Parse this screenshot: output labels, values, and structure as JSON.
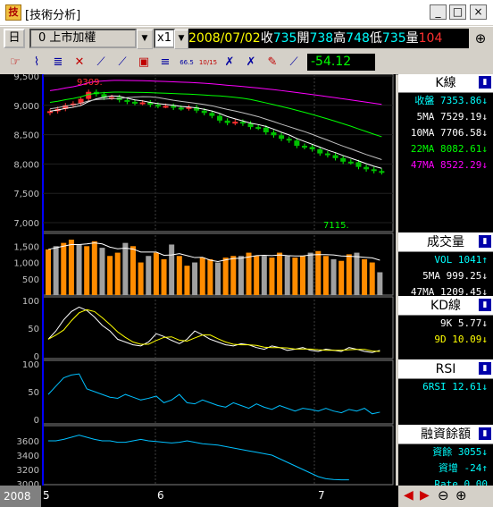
{
  "window": {
    "title": "[技術分析]",
    "min": "_",
    "max": "□",
    "close": "×"
  },
  "toolbar": {
    "period": "日",
    "stock": "0  上市加權",
    "multiplier": "x1",
    "date": "2008/07/02",
    "close_label": "收",
    "close_value": "735",
    "open_label": "開",
    "open_value": "738",
    "high_label": "高",
    "high_value": "748",
    "low_label": "低",
    "low_value": "735",
    "vol_label": "量",
    "vol_value": "104",
    "right_icon": "⊕",
    "change_value": "-54.12"
  },
  "tools": [
    {
      "name": "pointer-tool-icon",
      "glyph": "☞"
    },
    {
      "name": "k-line-tool-icon",
      "glyph": "⌇"
    },
    {
      "name": "candle-tool-icon",
      "glyph": "≣"
    },
    {
      "name": "cross-tool-icon",
      "glyph": "✕"
    },
    {
      "name": "fan-tool-icon",
      "glyph": "⟋"
    },
    {
      "name": "gann-tool-icon",
      "glyph": "⟋"
    },
    {
      "name": "box-tool-icon",
      "glyph": "▣"
    },
    {
      "name": "lines-tool-icon",
      "glyph": "≡"
    },
    {
      "name": "fib-66-tool-icon",
      "glyph": "66.5"
    },
    {
      "name": "fib-1015-tool-icon",
      "glyph": "10/15"
    },
    {
      "name": "delete-tool-icon",
      "glyph": "✗"
    },
    {
      "name": "erase-tool-icon",
      "glyph": "✗"
    },
    {
      "name": "pen-tool-icon",
      "glyph": "✎"
    },
    {
      "name": "line-tool-icon",
      "glyph": "⟋"
    }
  ],
  "panels": {
    "k": {
      "title": "K線",
      "rows": [
        {
          "label": "收盤",
          "value": "7353.86↓",
          "color": "#00ffff"
        },
        {
          "label": "5MA",
          "value": "7529.19↓",
          "color": "#ffffff"
        },
        {
          "label": "10MA",
          "value": "7706.58↓",
          "color": "#ffffff"
        },
        {
          "label": "22MA",
          "value": "8082.61↓",
          "color": "#00ff00"
        },
        {
          "label": "47MA",
          "value": "8522.29↓",
          "color": "#ff00ff"
        }
      ],
      "y_ticks": [
        "9,500",
        "9,000",
        "8,500",
        "8,000",
        "7,500",
        "7,000"
      ],
      "high_mark": "9309.",
      "low_mark": "7115."
    },
    "vol": {
      "title": "成交量",
      "rows": [
        {
          "label": "VOL",
          "value": "1041↑",
          "color": "#00ffff"
        },
        {
          "label": "5MA",
          "value": "999.25↓",
          "color": "#ffffff"
        },
        {
          "label": "47MA",
          "value": "1209.45↓",
          "color": "#ffffff"
        }
      ],
      "y_ticks": [
        "1,500",
        "1,000",
        "500"
      ]
    },
    "kd": {
      "title": "KD線",
      "rows": [
        {
          "label": "9K",
          "value": "5.77↓",
          "color": "#ffffff"
        },
        {
          "label": "9D",
          "value": "10.09↓",
          "color": "#ffff00"
        }
      ],
      "y_ticks": [
        "100",
        "50",
        "0"
      ]
    },
    "rsi": {
      "title": "RSI",
      "rows": [
        {
          "label": "6RSI",
          "value": "12.61↓",
          "color": "#00ffff"
        }
      ],
      "y_ticks": [
        "100",
        "50",
        "0"
      ]
    },
    "margin": {
      "title": "融資餘額",
      "rows": [
        {
          "label": "資餘",
          "value": "3055↓",
          "color": "#00ffff"
        },
        {
          "label": "資增",
          "value": "-24↑",
          "color": "#00ffff"
        },
        {
          "label": "Rate",
          "value": "0.00",
          "color": "#00ffff"
        }
      ],
      "y_ticks": [
        "3600",
        "3400",
        "3200",
        "3000"
      ]
    }
  },
  "x_axis": {
    "year": "2008",
    "months": [
      "5",
      "6",
      "7"
    ]
  },
  "nav": {
    "left": "◀",
    "right": "▶",
    "zoom_out": "⊖",
    "zoom_in": "⊕"
  }
}
